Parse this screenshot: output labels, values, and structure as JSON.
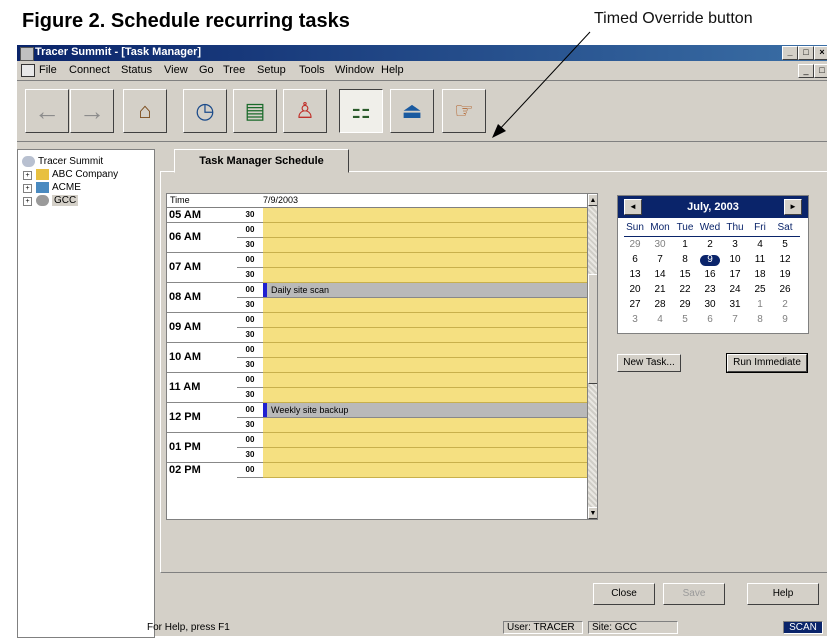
{
  "figure": {
    "title": "Figure 2. Schedule recurring tasks",
    "callout": "Timed Override button"
  },
  "window": {
    "title": "Tracer Summit - [Task Manager]",
    "controls": {
      "min": "_",
      "restore": "□",
      "close": "×"
    },
    "menu": [
      "File",
      "Connect",
      "Status",
      "View",
      "Go",
      "Tree",
      "Setup",
      "Tools",
      "Window",
      "Help"
    ]
  },
  "toolbar": {
    "back": "←",
    "forward": "→",
    "home": "⌂",
    "clock": "◷",
    "sheet": "▤",
    "bell": "♙",
    "tree": "⚏",
    "alarm": "⏏",
    "override": "☞"
  },
  "tree": {
    "root": "Tracer Summit",
    "items": [
      "ABC Company",
      "ACME",
      "GCC"
    ],
    "expander": "+"
  },
  "tab": {
    "label": "Task Manager Schedule"
  },
  "schedule": {
    "time_header": "Time",
    "date_header": "7/9/2003",
    "hours": [
      "05 AM",
      "06 AM",
      "07 AM",
      "08 AM",
      "09 AM",
      "10 AM",
      "11 AM",
      "12 PM",
      "01 PM",
      "02 PM"
    ],
    "minutes": [
      "30",
      "00",
      "30",
      "00",
      "30",
      "00",
      "30",
      "00",
      "30",
      "00",
      "30",
      "00",
      "30",
      "00",
      "30",
      "00",
      "30",
      "00"
    ],
    "events": [
      {
        "time": "08 AM 00",
        "label": "Daily site scan"
      },
      {
        "time": "12 PM 00",
        "label": "Weekly site backup"
      }
    ],
    "scroll_up": "▲",
    "scroll_down": "▼"
  },
  "calendar": {
    "month": "July, 2003",
    "prev": "◄",
    "next": "►",
    "days": [
      "Sun",
      "Mon",
      "Tue",
      "Wed",
      "Thu",
      "Fri",
      "Sat"
    ],
    "weeks": [
      [
        "29",
        "30",
        "1",
        "2",
        "3",
        "4",
        "5"
      ],
      [
        "6",
        "7",
        "8",
        "9",
        "10",
        "11",
        "12"
      ],
      [
        "13",
        "14",
        "15",
        "16",
        "17",
        "18",
        "19"
      ],
      [
        "20",
        "21",
        "22",
        "23",
        "24",
        "25",
        "26"
      ],
      [
        "27",
        "28",
        "29",
        "30",
        "31",
        "1",
        "2"
      ],
      [
        "3",
        "4",
        "5",
        "6",
        "7",
        "8",
        "9"
      ]
    ],
    "selected": "9"
  },
  "buttons": {
    "new_task": "New Task...",
    "run_immediate": "Run Immediate",
    "close": "Close",
    "save": "Save",
    "help": "Help"
  },
  "status": {
    "help": "For Help, press F1",
    "user": "User: TRACER",
    "site": "Site: GCC",
    "scan": "SCAN"
  },
  "colors": {
    "title_bar": "#0a246a",
    "schedule_slot": "#f5e081",
    "event": "#b9b9b9",
    "event_marker": "#2020d0"
  }
}
